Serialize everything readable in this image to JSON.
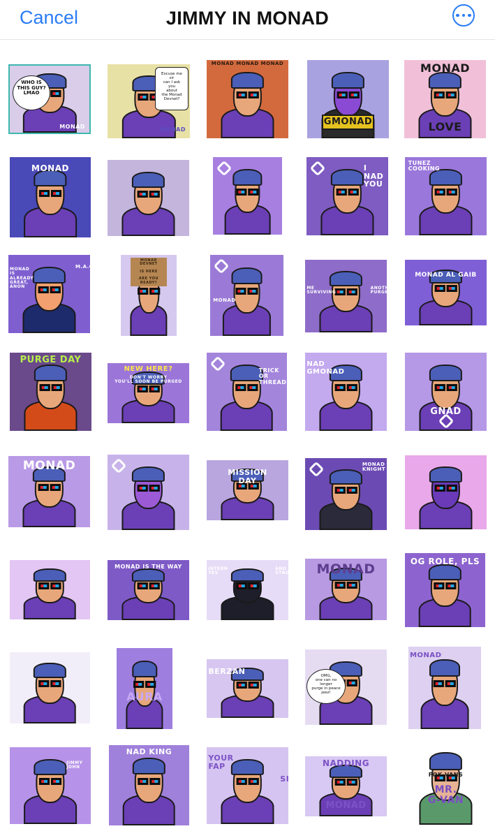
{
  "nav": {
    "cancel_label": "Cancel",
    "title": "JIMMY IN MONAD",
    "more_icon": "ellipsis-circle-icon"
  },
  "colors": {
    "accent": "#2a7cf6",
    "purple": "#8e5bd6"
  },
  "stickers": [
    {
      "name": "who-is-this-guy",
      "bg": "#d9cdea",
      "captions": [],
      "bubbles": [
        "WHO IS\nTHIS GUY?\nLMAO"
      ],
      "extra_text": [
        "MONAD"
      ]
    },
    {
      "name": "excuse-me-sir",
      "bg": "#e8e1a6",
      "captions": [],
      "bubbles": [
        "Excuse me sir\ncan I ask you\nabout\nthe Monad\nDevnet?"
      ],
      "extra_text": [
        "MONAD"
      ]
    },
    {
      "name": "monad-pattern",
      "bg": "#d36a3e",
      "captions": [
        "MONAD MONAD MONAD"
      ],
      "bubbles": [],
      "extra_text": []
    },
    {
      "name": "gmonad",
      "bg": "#a9a2e0",
      "captions": [
        "GMONAD"
      ],
      "bubbles": [],
      "extra_text": []
    },
    {
      "name": "monad-love",
      "bg": "#f1c0d8",
      "captions": [
        "MONAD",
        "LOVE"
      ],
      "bubbles": [],
      "extra_text": []
    },
    {
      "name": "monad-cap",
      "bg": "#4a49b8",
      "captions": [
        "MONAD"
      ],
      "bubbles": [],
      "extra_text": []
    },
    {
      "name": "beanie-jimmy",
      "bg": "#c4b5dd",
      "captions": [],
      "bubbles": [],
      "extra_text": []
    },
    {
      "name": "redhead",
      "bg": "#a77fe0",
      "captions": [],
      "bubbles": [],
      "extra_text": []
    },
    {
      "name": "i-nad-you",
      "bg": "#7e5cc2",
      "captions": [
        "I\nNAD\nYOU"
      ],
      "bubbles": [],
      "extra_text": []
    },
    {
      "name": "tunez-cooking",
      "bg": "#9a77db",
      "captions": [
        "TUNEZ\nCOOKING"
      ],
      "bubbles": [],
      "extra_text": []
    },
    {
      "name": "maga",
      "bg": "#7f5fd0",
      "captions": [
        "M.A.G.A"
      ],
      "bubbles": [],
      "extra_text": [
        "MONAD\nIS\nALREADY\nGREAT,\nANON"
      ]
    },
    {
      "name": "devnet-sign",
      "bg": "#d6c9ef",
      "captions": [],
      "bubbles": [],
      "extra_text": [
        "MONAD\nDEVNET\n\nIS HERE\n\nARE YOU\nREADY?"
      ]
    },
    {
      "name": "salt-bae",
      "bg": "#9a7ad6",
      "captions": [
        "MONAD"
      ],
      "bubbles": [],
      "extra_text": []
    },
    {
      "name": "me-surviving",
      "bg": "#8e6cc9",
      "captions": [
        "ME\nSURVIVING",
        "ANOTHER\nPURGE"
      ],
      "bubbles": [],
      "extra_text": []
    },
    {
      "name": "monad-al-gaib",
      "bg": "#7f5fd6",
      "captions": [
        "MONAD AL GAIB"
      ],
      "bubbles": [],
      "extra_text": []
    },
    {
      "name": "purge-day",
      "bg": "#6a4a8a",
      "captions": [
        "PURGE DAY"
      ],
      "bubbles": [],
      "extra_text": []
    },
    {
      "name": "new-here",
      "bg": "#9b76d8",
      "captions": [
        "NEW HERE?",
        "DON'T WORRY\nYOU'LL SOON BE PURGED"
      ],
      "bubbles": [],
      "extra_text": []
    },
    {
      "name": "trick-or-thread",
      "bg": "#a485dc",
      "captions": [
        "TRICK\nOR\nTHREAD"
      ],
      "bubbles": [],
      "extra_text": []
    },
    {
      "name": "nad-gmonad",
      "bg": "#c3a9ee",
      "captions": [
        "NAD\nGMONAD"
      ],
      "bubbles": [],
      "extra_text": []
    },
    {
      "name": "gnad",
      "bg": "#b598e6",
      "captions": [
        "GNAD"
      ],
      "bubbles": [],
      "extra_text": []
    },
    {
      "name": "monad-facepalm",
      "bg": "#b99ae6",
      "captions": [
        "MONAD"
      ],
      "bubbles": [],
      "extra_text": []
    },
    {
      "name": "hedgehog",
      "bg": "#c7b3ea",
      "captions": [],
      "bubbles": [],
      "extra_text": []
    },
    {
      "name": "mission-day",
      "bg": "#b9a6df",
      "captions": [
        "MISSION\nDAY"
      ],
      "bubbles": [],
      "extra_text": []
    },
    {
      "name": "monad-knight",
      "bg": "#6b4bb3",
      "captions": [
        "MONAD\nKNIGHT"
      ],
      "bubbles": [],
      "extra_text": []
    },
    {
      "name": "hedgehog-face",
      "bg": "#e9a8ea",
      "captions": [],
      "bubbles": [],
      "extra_text": []
    },
    {
      "name": "tigers-crew",
      "bg": "#e3c6f3",
      "captions": [],
      "bubbles": [],
      "extra_text": []
    },
    {
      "name": "monad-is-the-way",
      "bg": "#7d5ac6",
      "captions": [
        "MONAD IS THE WAY"
      ],
      "bubbles": [],
      "extra_text": []
    },
    {
      "name": "penguin",
      "bg": "#e7dcf7",
      "captions": [
        "INTERN\nYES",
        "AND\nSTRONG"
      ],
      "bubbles": [],
      "extra_text": []
    },
    {
      "name": "monad-sword",
      "bg": "#b79ae2",
      "captions": [
        "MONAD"
      ],
      "bubbles": [],
      "extra_text": []
    },
    {
      "name": "og-role-pls",
      "bg": "#8d64cf",
      "captions": [
        "OG ROLE, PLS"
      ],
      "bubbles": [],
      "extra_text": []
    },
    {
      "name": "ranger-trio",
      "bg": "#f2eef9",
      "captions": [],
      "bubbles": [],
      "extra_text": []
    },
    {
      "name": "aura",
      "bg": "#9e7edf",
      "captions": [
        "AURA"
      ],
      "bubbles": [],
      "extra_text": []
    },
    {
      "name": "berzan",
      "bg": "#d6c6f0",
      "captions": [
        "BERZAN"
      ],
      "bubbles": [],
      "extra_text": []
    },
    {
      "name": "purge-in-peace",
      "bg": "#e6dcf2",
      "captions": [],
      "bubbles": [
        "OMG,\none can no longer\npurge in peace\njeez!"
      ],
      "extra_text": []
    },
    {
      "name": "monad-tiger",
      "bg": "#ddd0f1",
      "captions": [
        "MONAD"
      ],
      "bubbles": [],
      "extra_text": []
    },
    {
      "name": "jimmy-beach",
      "bg": "#b693e8",
      "captions": [
        "JIMMY\nJOHN"
      ],
      "bubbles": [],
      "extra_text": []
    },
    {
      "name": "nad-king",
      "bg": "#9f80da",
      "captions": [
        "NAD KING"
      ],
      "bubbles": [],
      "extra_text": []
    },
    {
      "name": "your-fap-sister",
      "bg": "#d5c4f1",
      "captions": [
        "YOUR\nFAP",
        "SISTER"
      ],
      "bubbles": [],
      "extra_text": []
    },
    {
      "name": "nadding-monad",
      "bg": "#d8c8f4",
      "captions": [
        "NADDING",
        "MONAD"
      ],
      "bubbles": [],
      "extra_text": []
    },
    {
      "name": "mr-g-van",
      "bg": "#ffffff",
      "captions": [
        "FOK VANS",
        "MR.\nG-VAN"
      ],
      "bubbles": [],
      "extra_text": []
    }
  ]
}
